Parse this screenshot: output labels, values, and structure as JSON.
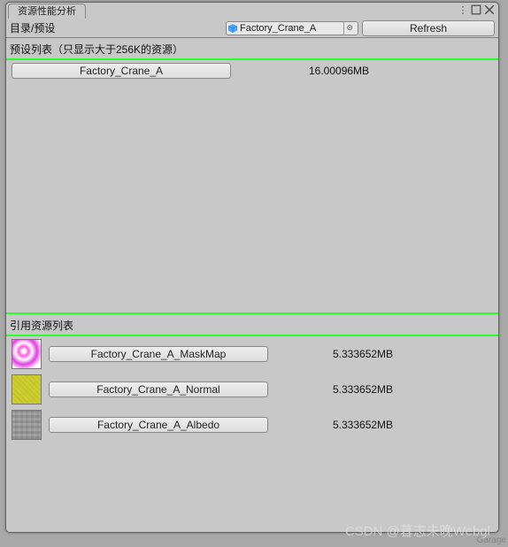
{
  "window": {
    "tab_title": "资源性能分析",
    "menu_icon": "vertical-dots",
    "maximize_icon": "maximize",
    "close_icon": "close"
  },
  "toolbar": {
    "path_label": "目录/预设",
    "object_name": "Factory_Crane_A",
    "cube_icon": "prefab-cube",
    "picker_icon": "object-picker",
    "refresh_label": "Refresh"
  },
  "preset_section": {
    "label": "预设列表（只显示大于256K的资源）",
    "items": [
      {
        "name": "Factory_Crane_A",
        "size": "16.00096MB"
      }
    ]
  },
  "ref_section": {
    "label": "引用资源列表",
    "items": [
      {
        "name": "Factory_Crane_A_MaskMap",
        "size": "5.333652MB",
        "thumb": "mask"
      },
      {
        "name": "Factory_Crane_A_Normal",
        "size": "5.333652MB",
        "thumb": "normal"
      },
      {
        "name": "Factory_Crane_A_Albedo",
        "size": "5.333652MB",
        "thumb": "albedo"
      }
    ]
  },
  "watermark": "CSDN @暮志未晚Webgl",
  "bg_hint": "Garage"
}
